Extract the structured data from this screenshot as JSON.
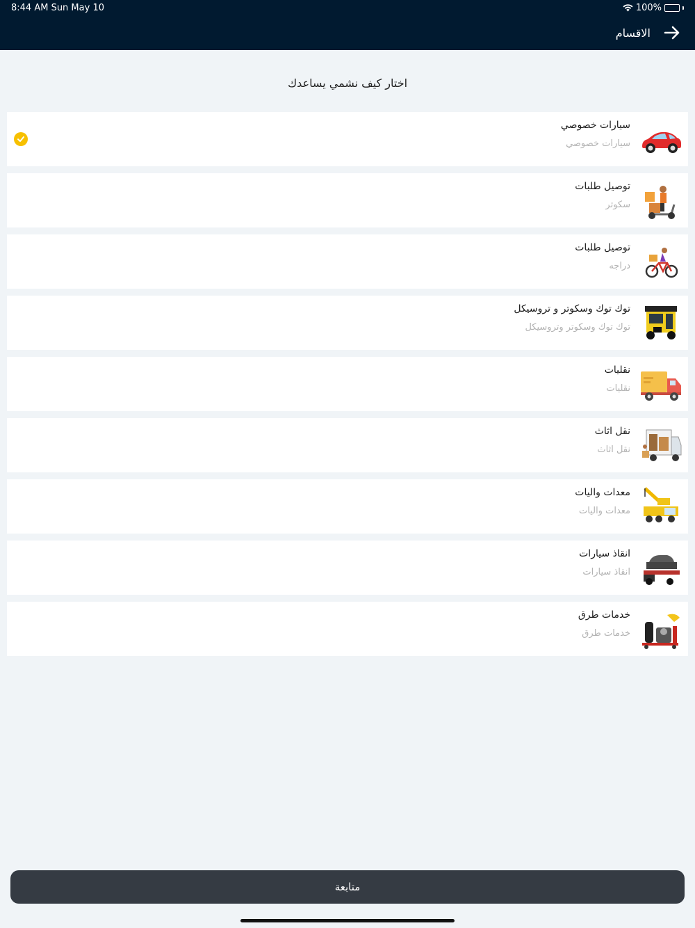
{
  "status_bar": {
    "time_date": "8:44 AM   Sun May 10",
    "battery": "100%",
    "battery_level": 1.0
  },
  "header": {
    "title": "الاقسام",
    "back_icon": "arrow-right-icon"
  },
  "subtitle": "اختار كيف نشمي يساعدك",
  "categories": [
    {
      "title": "سيارات خصوصي",
      "subtitle": "سيارات خصوصي",
      "icon": "car-icon",
      "selected": true
    },
    {
      "title": "توصيل طلبات",
      "subtitle": "سكوتر",
      "icon": "scooter-delivery-icon",
      "selected": false
    },
    {
      "title": "توصيل طلبات",
      "subtitle": "دراجه",
      "icon": "bicycle-delivery-icon",
      "selected": false
    },
    {
      "title": "توك توك وسكوتر و تروسيكل",
      "subtitle": "توك توك وسكوتر وتروسيكل",
      "icon": "tuktuk-icon",
      "selected": false
    },
    {
      "title": "نقليات",
      "subtitle": "نقليات",
      "icon": "truck-icon",
      "selected": false
    },
    {
      "title": "نقل اثاث",
      "subtitle": "نقل اثاث",
      "icon": "furniture-truck-icon",
      "selected": false
    },
    {
      "title": "معدات واليات",
      "subtitle": "معدات واليات",
      "icon": "crane-icon",
      "selected": false
    },
    {
      "title": "انقاذ سيارات",
      "subtitle": "انقاذ سيارات",
      "icon": "tow-truck-icon",
      "selected": false
    },
    {
      "title": "خدمات  طرق",
      "subtitle": "خدمات  طرق",
      "icon": "road-service-icon",
      "selected": false
    }
  ],
  "continue_label": "متابعة",
  "colors": {
    "header_bg": "#011a30",
    "page_bg": "#f0f4f7",
    "button_bg": "#353b43",
    "check_color": "#f7c000"
  }
}
